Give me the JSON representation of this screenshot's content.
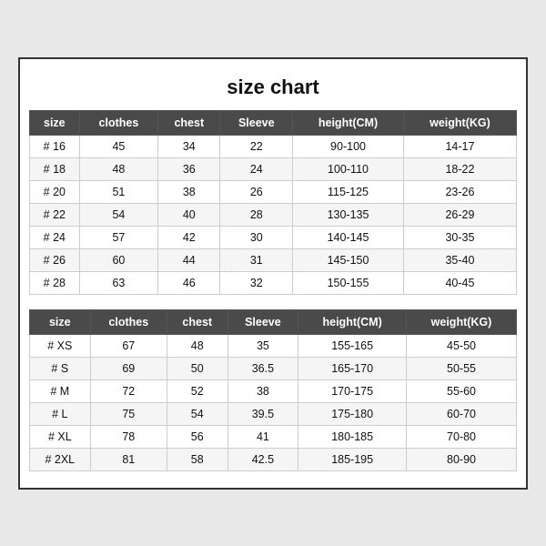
{
  "title": "size chart",
  "tables": [
    {
      "id": "table1",
      "headers": [
        "size",
        "clothes",
        "chest",
        "Sleeve",
        "height(CM)",
        "weight(KG)"
      ],
      "rows": [
        [
          "# 16",
          "45",
          "34",
          "22",
          "90-100",
          "14-17"
        ],
        [
          "# 18",
          "48",
          "36",
          "24",
          "100-110",
          "18-22"
        ],
        [
          "# 20",
          "51",
          "38",
          "26",
          "115-125",
          "23-26"
        ],
        [
          "# 22",
          "54",
          "40",
          "28",
          "130-135",
          "26-29"
        ],
        [
          "# 24",
          "57",
          "42",
          "30",
          "140-145",
          "30-35"
        ],
        [
          "# 26",
          "60",
          "44",
          "31",
          "145-150",
          "35-40"
        ],
        [
          "# 28",
          "63",
          "46",
          "32",
          "150-155",
          "40-45"
        ]
      ]
    },
    {
      "id": "table2",
      "headers": [
        "size",
        "clothes",
        "chest",
        "Sleeve",
        "height(CM)",
        "weight(KG)"
      ],
      "rows": [
        [
          "# XS",
          "67",
          "48",
          "35",
          "155-165",
          "45-50"
        ],
        [
          "# S",
          "69",
          "50",
          "36.5",
          "165-170",
          "50-55"
        ],
        [
          "# M",
          "72",
          "52",
          "38",
          "170-175",
          "55-60"
        ],
        [
          "# L",
          "75",
          "54",
          "39.5",
          "175-180",
          "60-70"
        ],
        [
          "# XL",
          "78",
          "56",
          "41",
          "180-185",
          "70-80"
        ],
        [
          "# 2XL",
          "81",
          "58",
          "42.5",
          "185-195",
          "80-90"
        ]
      ]
    }
  ]
}
